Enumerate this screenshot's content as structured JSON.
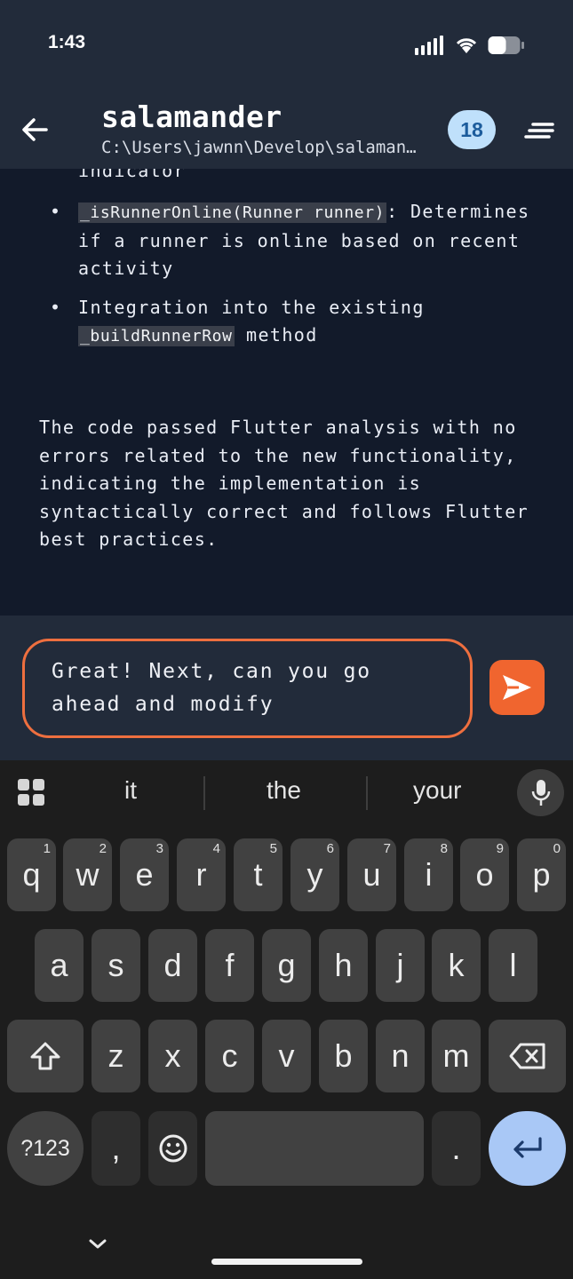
{
  "status_bar": {
    "time": "1:43"
  },
  "header": {
    "title": "salamander",
    "subtitle": "C:\\Users\\jawnn\\Develop\\salamander",
    "badge_count": "18"
  },
  "message": {
    "cut_line": "indicator",
    "bullets": [
      {
        "code": "_isRunnerOnline(Runner runner)",
        "text": ": Determines if a runner is online based on recent activity"
      },
      {
        "text_before": "Integration into the existing ",
        "code": "_buildRunnerRow",
        "text_after": " method"
      }
    ],
    "paragraph": "The code passed Flutter analysis with no errors related to the new functionality, indicating the implementation is syntactically correct and follows Flutter best practices."
  },
  "composer": {
    "value": "Great! Next, can you go ahead and modify"
  },
  "keyboard": {
    "suggestions": [
      "it",
      "the",
      "your"
    ],
    "row1": [
      {
        "k": "q",
        "h": "1"
      },
      {
        "k": "w",
        "h": "2"
      },
      {
        "k": "e",
        "h": "3"
      },
      {
        "k": "r",
        "h": "4"
      },
      {
        "k": "t",
        "h": "5"
      },
      {
        "k": "y",
        "h": "6"
      },
      {
        "k": "u",
        "h": "7"
      },
      {
        "k": "i",
        "h": "8"
      },
      {
        "k": "o",
        "h": "9"
      },
      {
        "k": "p",
        "h": "0"
      }
    ],
    "row2": [
      "a",
      "s",
      "d",
      "f",
      "g",
      "h",
      "j",
      "k",
      "l"
    ],
    "row3": [
      "z",
      "x",
      "c",
      "v",
      "b",
      "n",
      "m"
    ],
    "symbols_label": "?123",
    "comma": ",",
    "period": "."
  },
  "colors": {
    "accent": "#f0652f",
    "badge_bg": "#bfe0fb",
    "enter_key": "#a9c8f6"
  },
  "icons": [
    "back-arrow-icon",
    "menu-lines-icon",
    "send-icon",
    "apps-grid-icon",
    "mic-icon",
    "shift-icon",
    "backspace-icon",
    "emoji-icon",
    "enter-icon",
    "chevron-down-icon",
    "signal-icon",
    "wifi-icon",
    "battery-icon"
  ]
}
